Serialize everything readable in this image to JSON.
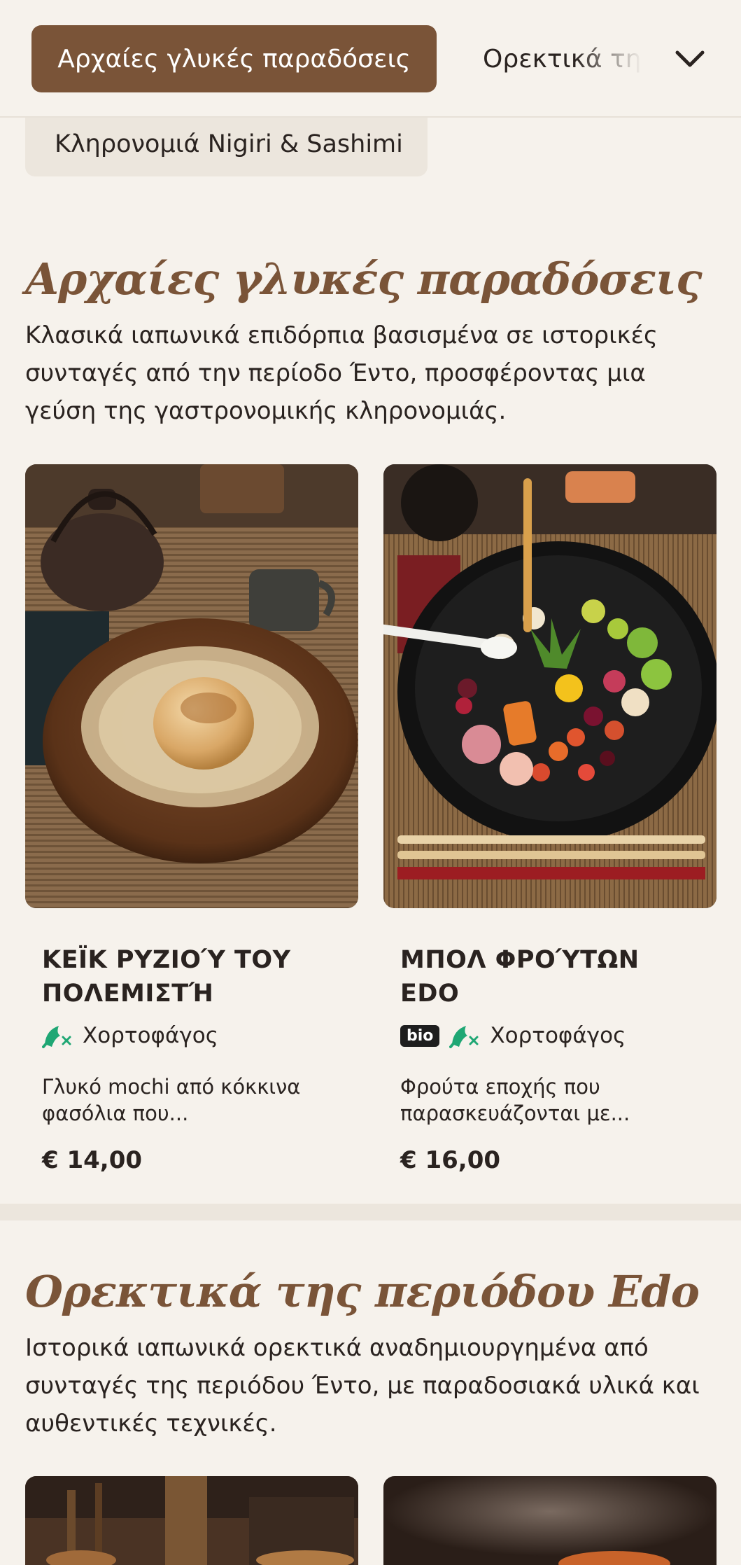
{
  "category_bar": {
    "active": "Αρχαίες γλυκές παραδόσεις",
    "next": "Ορεκτικά της περιόδου Edo",
    "second_row": "Κληρονομιά Nigiri & Sashimi"
  },
  "sections": [
    {
      "title": "Αρχαίες γλυκές παραδόσεις",
      "description": "Κλασικά ιαπωνικά επιδόρπια βασισμένα σε ιστορικές συνταγές από την περίοδο Έντο, προσφέροντας μια γεύση της γαστρονομικής κληρονομιάς.",
      "items": [
        {
          "name": "Κεϊκ ρυζιού του πολεμιστή",
          "tags": [
            "Χορτοφάγος"
          ],
          "bio": false,
          "description": "Γλυκό mochi από κόκκινα φασόλια που...",
          "price": "€ 14,00",
          "image_icon": "mochi-dessert-photo"
        },
        {
          "name": "Μπολ φρούτων Edo",
          "tags": [
            "Χορτοφάγος"
          ],
          "bio": true,
          "bio_label": "bio",
          "description": "Φρούτα εποχής που παρασκευάζονται με...",
          "price": "€ 16,00",
          "image_icon": "fruit-bowl-photo"
        }
      ]
    },
    {
      "title": "Ορεκτικά της περιόδου Edo",
      "description": "Ιστορικά ιαπωνικά ορεκτικά αναδημιουργημένα από συνταγές της περιόδου Έντο, με παραδοσιακά υλικά και αυθεντικές τεχνικές."
    }
  ],
  "colors": {
    "background": "#f6f2ec",
    "accent": "#7a5438",
    "vegetarian_green": "#1fa774"
  }
}
